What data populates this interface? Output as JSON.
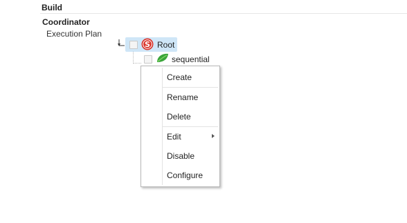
{
  "header": {
    "title": "Build"
  },
  "coordinator": {
    "title": "Coordinator",
    "plan_label": "Execution Plan"
  },
  "tree": {
    "root": {
      "label": "Root",
      "icon": "s-circle-icon",
      "color": "#d9342b"
    },
    "child": {
      "label": "sequential",
      "icon": "leaf-icon",
      "color": "#3aa53a"
    }
  },
  "context_menu": {
    "items": [
      "Create",
      "Rename",
      "Delete",
      "Edit",
      "Disable",
      "Configure"
    ]
  },
  "colors": {
    "selection": "#cfe6f7"
  }
}
